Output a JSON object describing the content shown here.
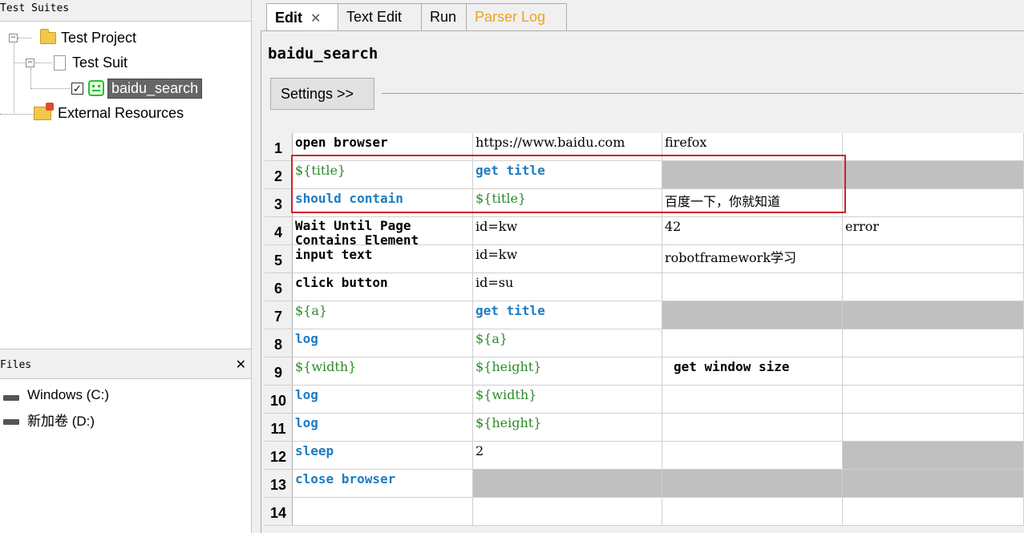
{
  "left_panel": {
    "suites_title": "Test Suites",
    "tree": {
      "project": "Test Project",
      "suite": "Test Suit",
      "test_case": "baidu_search",
      "external": "External Resources"
    },
    "files_title": "Files",
    "files_close": "✕",
    "drives": [
      "Windows (C:)",
      "新加卷 (D:)"
    ]
  },
  "tabs": [
    {
      "label": "Edit",
      "active": true,
      "close": "✕"
    },
    {
      "label": "Text Edit"
    },
    {
      "label": "Run"
    },
    {
      "label": "Parser Log",
      "color": "#f0a020"
    }
  ],
  "editor": {
    "suite_name": "baidu_search",
    "settings_button": "Settings >>"
  },
  "grid": {
    "rows": [
      {
        "n": "1",
        "c1": "open browser",
        "c2": "https://www.baidu.com",
        "c3": "firefox",
        "c4": ""
      },
      {
        "n": "2",
        "c1": "${title}",
        "c2": "get title",
        "c3": "",
        "c4": ""
      },
      {
        "n": "3",
        "c1": "should contain",
        "c2": "${title}",
        "c3": "百度一下，你就知道",
        "c4": ""
      },
      {
        "n": "4",
        "c1": "Wait Until Page Contains Element",
        "c2": "id=kw",
        "c3": "42",
        "c4": "error"
      },
      {
        "n": "5",
        "c1": "input text",
        "c2": "id=kw",
        "c3": "robotframework学习",
        "c4": ""
      },
      {
        "n": "6",
        "c1": "click button",
        "c2": "id=su",
        "c3": "",
        "c4": ""
      },
      {
        "n": "7",
        "c1": "${a}",
        "c2": "get title",
        "c3": "",
        "c4": ""
      },
      {
        "n": "8",
        "c1": "log",
        "c2": "${a}",
        "c3": "",
        "c4": ""
      },
      {
        "n": "9",
        "c1": "${width}",
        "c2": "${height}",
        "c3": "get window size",
        "c4": ""
      },
      {
        "n": "10",
        "c1": "log",
        "c2": "${width}",
        "c3": "",
        "c4": ""
      },
      {
        "n": "11",
        "c1": "log",
        "c2": "${height}",
        "c3": "",
        "c4": ""
      },
      {
        "n": "12",
        "c1": "sleep",
        "c2": "2",
        "c3": "",
        "c4": ""
      },
      {
        "n": "13",
        "c1": "close browser",
        "c2": "",
        "c3": "",
        "c4": ""
      },
      {
        "n": "14",
        "c1": "",
        "c2": "",
        "c3": "",
        "c4": ""
      }
    ]
  },
  "colors": {
    "keyword_blue": "#1c7cc3",
    "variable_green": "#2a8a2a",
    "disabled_grey": "#c0c0c0",
    "highlight_red": "#d0202a"
  }
}
